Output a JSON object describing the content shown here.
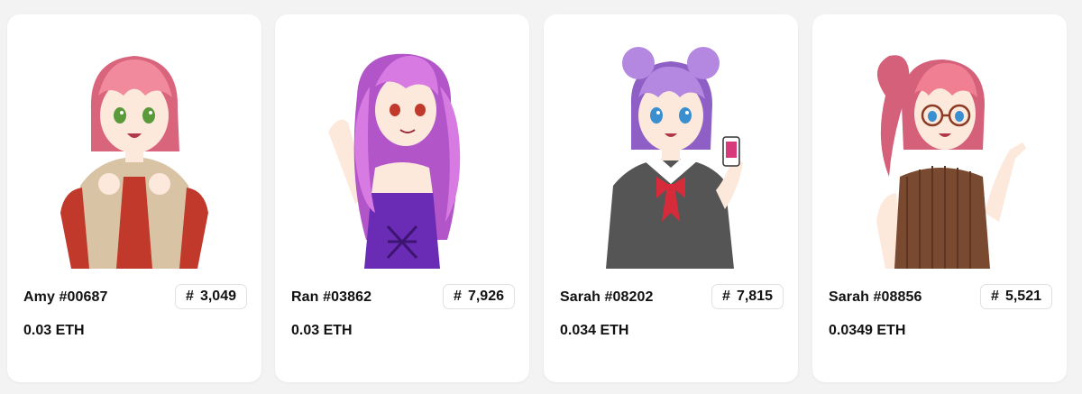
{
  "cards": [
    {
      "name": "Amy #00687",
      "rank_symbol": "#",
      "rank": "3,049",
      "price": "0.03 ETH",
      "palette": {
        "hair": "#f08a9c",
        "hair_shade": "#d9657c",
        "skin": "#fde8dc",
        "top": "#d8c3a5",
        "top2": "#c0392b",
        "eyes": "#5a9a3a"
      }
    },
    {
      "name": "Ran #03862",
      "rank_symbol": "#",
      "rank": "7,926",
      "price": "0.03 ETH",
      "palette": {
        "hair": "#d77be3",
        "hair_shade": "#b255c9",
        "skin": "#fde8dc",
        "top": "#6a2bb5",
        "top2": "#3d1570",
        "eyes": "#c0392b"
      }
    },
    {
      "name": "Sarah #08202",
      "rank_symbol": "#",
      "rank": "7,815",
      "price": "0.034 ETH",
      "palette": {
        "hair": "#b487e0",
        "hair_shade": "#8e5fc4",
        "skin": "#fde8dc",
        "top": "#555555",
        "top2": "#d62b3a",
        "eyes": "#3a8fd0"
      }
    },
    {
      "name": "Sarah #08856",
      "rank_symbol": "#",
      "rank": "5,521",
      "price": "0.0349 ETH",
      "palette": {
        "hair": "#f07f93",
        "hair_shade": "#d4607a",
        "skin": "#fde8dc",
        "top": "#7a4a30",
        "top2": "#5e3520",
        "eyes": "#3a8fd0"
      }
    }
  ]
}
